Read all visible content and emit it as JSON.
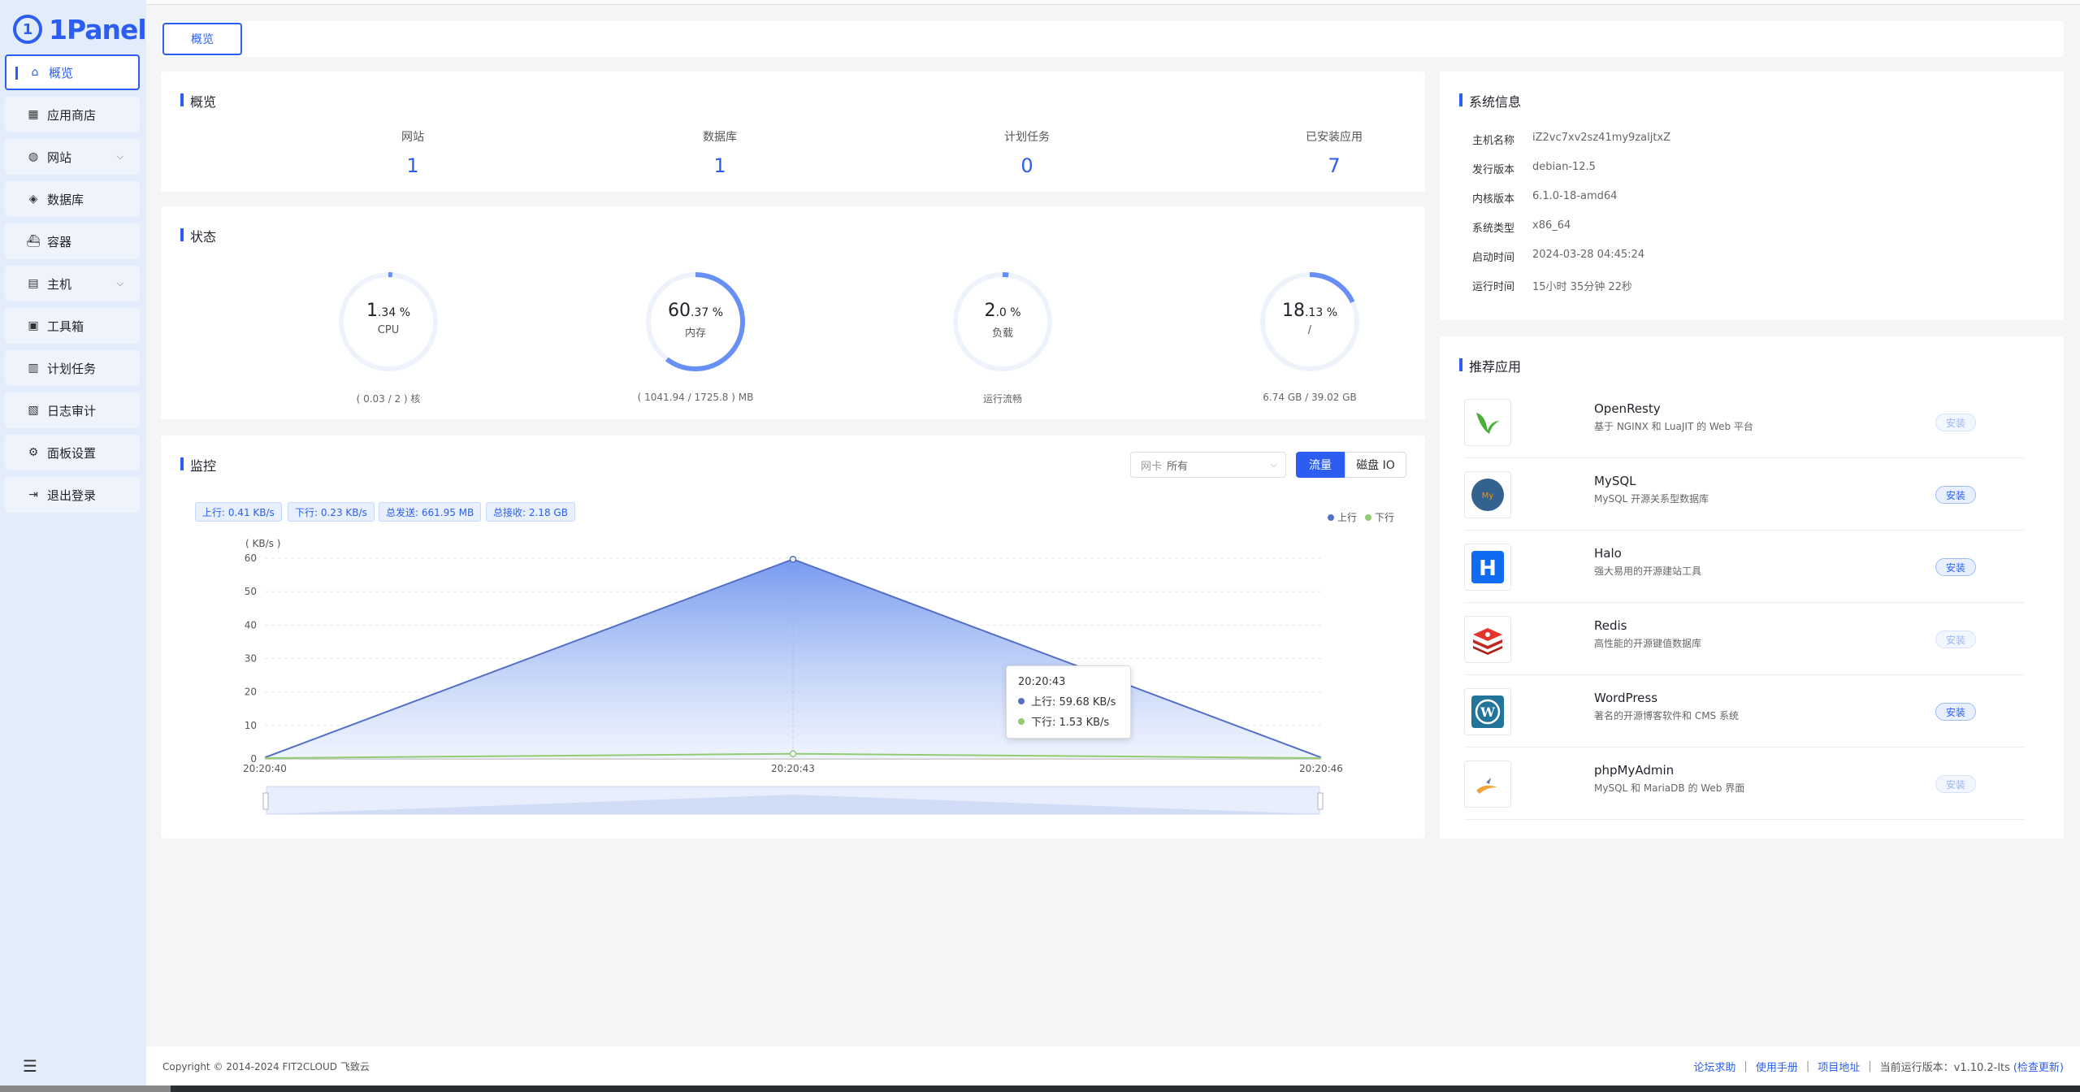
{
  "brand": {
    "name": "1Panel",
    "mark": "1"
  },
  "sidebar": {
    "items": [
      {
        "label": "概览",
        "icon": "home-icon",
        "active": true,
        "has_children": false
      },
      {
        "label": "应用商店",
        "icon": "grid-icon",
        "has_children": false
      },
      {
        "label": "网站",
        "icon": "globe-icon",
        "has_children": true
      },
      {
        "label": "数据库",
        "icon": "database-icon",
        "has_children": false
      },
      {
        "label": "容器",
        "icon": "docker-icon",
        "has_children": false
      },
      {
        "label": "主机",
        "icon": "server-icon",
        "has_children": true
      },
      {
        "label": "工具箱",
        "icon": "toolbox-icon",
        "has_children": false
      },
      {
        "label": "计划任务",
        "icon": "calendar-icon",
        "has_children": false
      },
      {
        "label": "日志审计",
        "icon": "log-icon",
        "has_children": false
      },
      {
        "label": "面板设置",
        "icon": "gear-icon",
        "has_children": false
      },
      {
        "label": "退出登录",
        "icon": "logout-icon",
        "has_children": false
      }
    ]
  },
  "tabs": [
    {
      "label": "概览"
    }
  ],
  "overview": {
    "title": "概览",
    "items": [
      {
        "label": "网站",
        "value": "1"
      },
      {
        "label": "数据库",
        "value": "1"
      },
      {
        "label": "计划任务",
        "value": "0"
      },
      {
        "label": "已安装应用",
        "value": "7"
      }
    ]
  },
  "status": {
    "title": "状态",
    "gauges": [
      {
        "int": "1",
        "dec": ".34 %",
        "name": "CPU",
        "percent": 1.34,
        "foot": "( 0.03 / 2 ) 核"
      },
      {
        "int": "60",
        "dec": ".37 %",
        "name": "内存",
        "percent": 60.37,
        "foot": "( 1041.94 / 1725.8 ) MB"
      },
      {
        "int": "2",
        "dec": ".0 %",
        "name": "负载",
        "percent": 2.0,
        "foot": "运行流畅"
      },
      {
        "int": "18",
        "dec": ".13 %",
        "name": "/",
        "percent": 18.13,
        "foot": "6.74 GB / 39.02 GB"
      }
    ]
  },
  "monitor": {
    "title": "监控",
    "nic_label": "网卡",
    "nic_value": "所有",
    "seg_traffic": "流量",
    "seg_disk": "磁盘 IO",
    "tags": [
      "上行: 0.41 KB/s",
      "下行: 0.23 KB/s",
      "总发送: 661.95 MB",
      "总接收: 2.18 GB"
    ],
    "tooltip": {
      "time": "20:20:43",
      "up": "上行:  59.68 KB/s",
      "down": "下行:  1.53 KB/s"
    }
  },
  "chart_data": {
    "type": "area",
    "ylabel": "( KB/s )",
    "ylim": [
      0,
      60
    ],
    "yticks": [
      0,
      10,
      20,
      30,
      40,
      50,
      60
    ],
    "x": [
      "20:20:40",
      "20:20:43",
      "20:20:46"
    ],
    "series": [
      {
        "name": "上行",
        "values": [
          0.41,
          59.68,
          0.41
        ],
        "color": "#5470c6"
      },
      {
        "name": "下行",
        "values": [
          0.23,
          1.53,
          0.23
        ],
        "color": "#91cc75"
      }
    ],
    "grid": true,
    "legend": "top-right"
  },
  "system_info": {
    "title": "系统信息",
    "rows": [
      {
        "label": "主机名称",
        "value": "iZ2vc7xv2sz41my9zaljtxZ"
      },
      {
        "label": "发行版本",
        "value": "debian-12.5"
      },
      {
        "label": "内核版本",
        "value": "6.1.0-18-amd64"
      },
      {
        "label": "系统类型",
        "value": "x86_64"
      },
      {
        "label": "启动时间",
        "value": "2024-03-28 04:45:24"
      },
      {
        "label": "运行时间",
        "value": "15小时 35分钟 22秒"
      }
    ]
  },
  "apps": {
    "title": "推荐应用",
    "items": [
      {
        "name": "OpenResty",
        "desc": "基于 NGINX 和 LuaJIT 的 Web 平台",
        "button": "安装",
        "enabled": false,
        "icon": "openresty-icon"
      },
      {
        "name": "MySQL",
        "desc": "MySQL 开源关系型数据库",
        "button": "安装",
        "enabled": true,
        "icon": "mysql-icon"
      },
      {
        "name": "Halo",
        "desc": "强大易用的开源建站工具",
        "button": "安装",
        "enabled": true,
        "icon": "halo-icon"
      },
      {
        "name": "Redis",
        "desc": "高性能的开源键值数据库",
        "button": "安装",
        "enabled": false,
        "icon": "redis-icon"
      },
      {
        "name": "WordPress",
        "desc": "著名的开源博客软件和 CMS 系统",
        "button": "安装",
        "enabled": true,
        "icon": "wordpress-icon"
      },
      {
        "name": "phpMyAdmin",
        "desc": "MySQL 和 MariaDB 的 Web 界面",
        "button": "安装",
        "enabled": false,
        "icon": "phpmyadmin-icon"
      }
    ]
  },
  "footer": {
    "copyright": "Copyright © 2014-2024 FIT2CLOUD 飞致云",
    "links": [
      "论坛求助",
      "使用手册",
      "项目地址"
    ],
    "version_label": "当前运行版本：v1.10.2-lts",
    "check_update": "(检查更新)"
  }
}
